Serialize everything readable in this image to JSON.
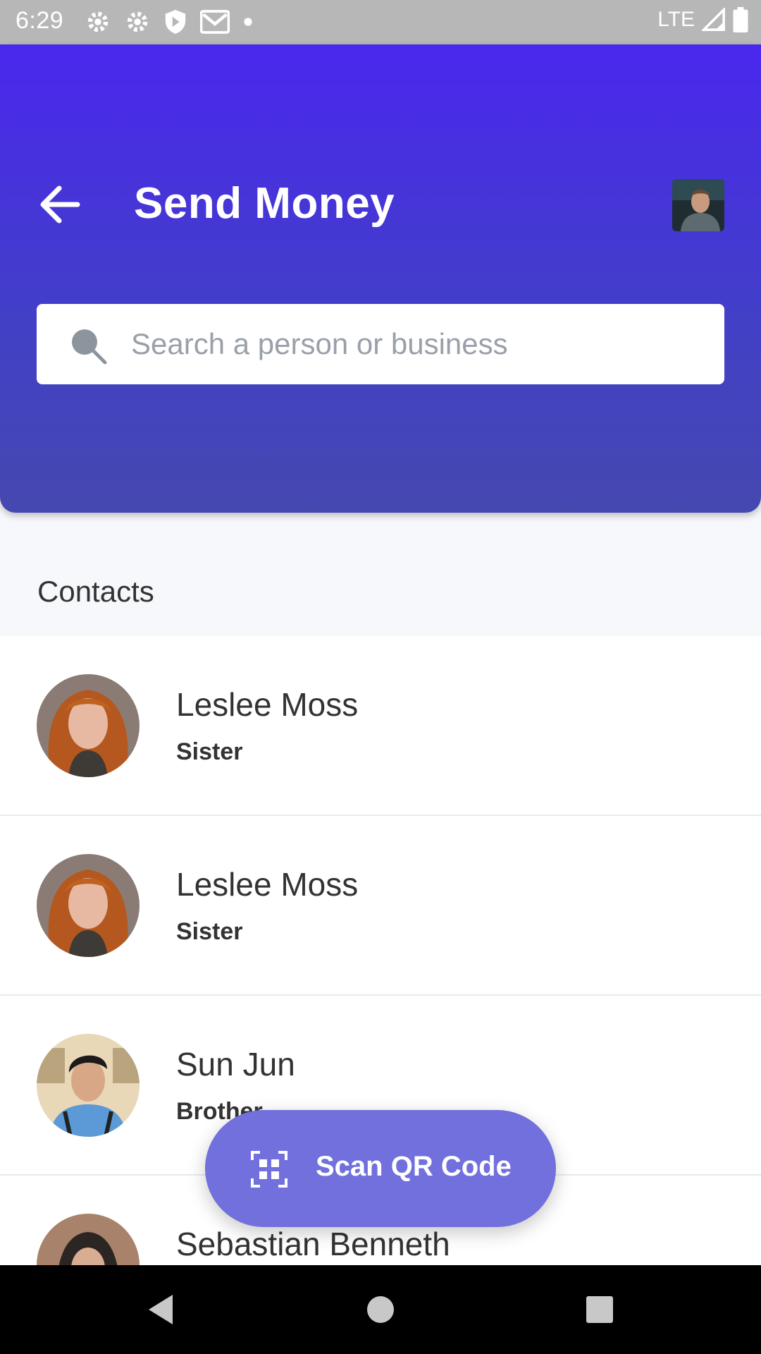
{
  "status_bar": {
    "time": "6:29",
    "network": "LTE"
  },
  "header": {
    "title": "Send Money",
    "background_gradient": [
      "#4a27ee",
      "#4648b0"
    ]
  },
  "search": {
    "placeholder": "Search a person or business",
    "value": ""
  },
  "contacts": {
    "section_title": "Contacts",
    "items": [
      {
        "name": "Leslee Moss",
        "relation": "Sister",
        "avatar": "woman-red-hair"
      },
      {
        "name": "Leslee Moss",
        "relation": "Sister",
        "avatar": "woman-red-hair"
      },
      {
        "name": "Sun Jun",
        "relation": "Brother",
        "avatar": "man-blue-shirt"
      },
      {
        "name": "Sebastian Benneth",
        "relation": "",
        "avatar": "woman-headscarf"
      }
    ]
  },
  "fab": {
    "label": "Scan QR Code",
    "icon": "qr-scan-icon",
    "color": "#7170dc"
  },
  "icons": {
    "back": "arrow-left-icon",
    "search": "search-icon",
    "nav": [
      "back-triangle-icon",
      "home-circle-icon",
      "recents-square-icon"
    ]
  }
}
